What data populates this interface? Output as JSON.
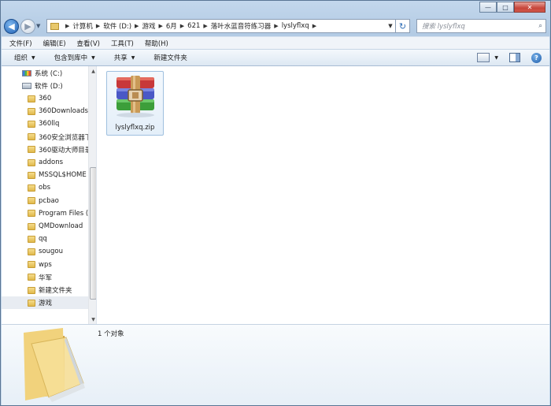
{
  "window": {
    "minimize_glyph": "—",
    "maximize_glyph": "□",
    "close_glyph": "✕"
  },
  "address": {
    "crumbs": [
      "计算机",
      "软件 (D:)",
      "游戏",
      "6月",
      "621",
      "落叶水蓝音符练习器",
      "lyslyflxq"
    ],
    "search_placeholder": "搜索 lyslyflxq"
  },
  "menu": {
    "items": [
      "文件(F)",
      "编辑(E)",
      "查看(V)",
      "工具(T)",
      "帮助(H)"
    ]
  },
  "commands": {
    "organize": "组织",
    "include_library": "包含到库中",
    "share": "共享",
    "new_folder": "新建文件夹"
  },
  "nav": {
    "drives": [
      {
        "label": "系统 (C:)",
        "icon": "system-drive-icon"
      },
      {
        "label": "软件 (D:)",
        "icon": "drive-icon"
      }
    ],
    "folders": [
      "360",
      "360Downloads",
      "360llq",
      "360安全浏览器下",
      "360驱动大师目录",
      "addons",
      "MSSQL$HOME",
      "obs",
      "pcbao",
      "Program Files (",
      "QMDownload",
      "qq",
      "sougou",
      "wps",
      "华军",
      "新建文件夹",
      "游戏"
    ],
    "selected": "游戏"
  },
  "content": {
    "files": [
      {
        "name": "lyslyflxq.zip",
        "icon": "winrar-archive-icon"
      }
    ]
  },
  "details": {
    "count_text": "1 个对象"
  },
  "colors": {
    "accent": "#2f6db5",
    "folder": "#e1b94c",
    "selection": "#e4eff9"
  }
}
